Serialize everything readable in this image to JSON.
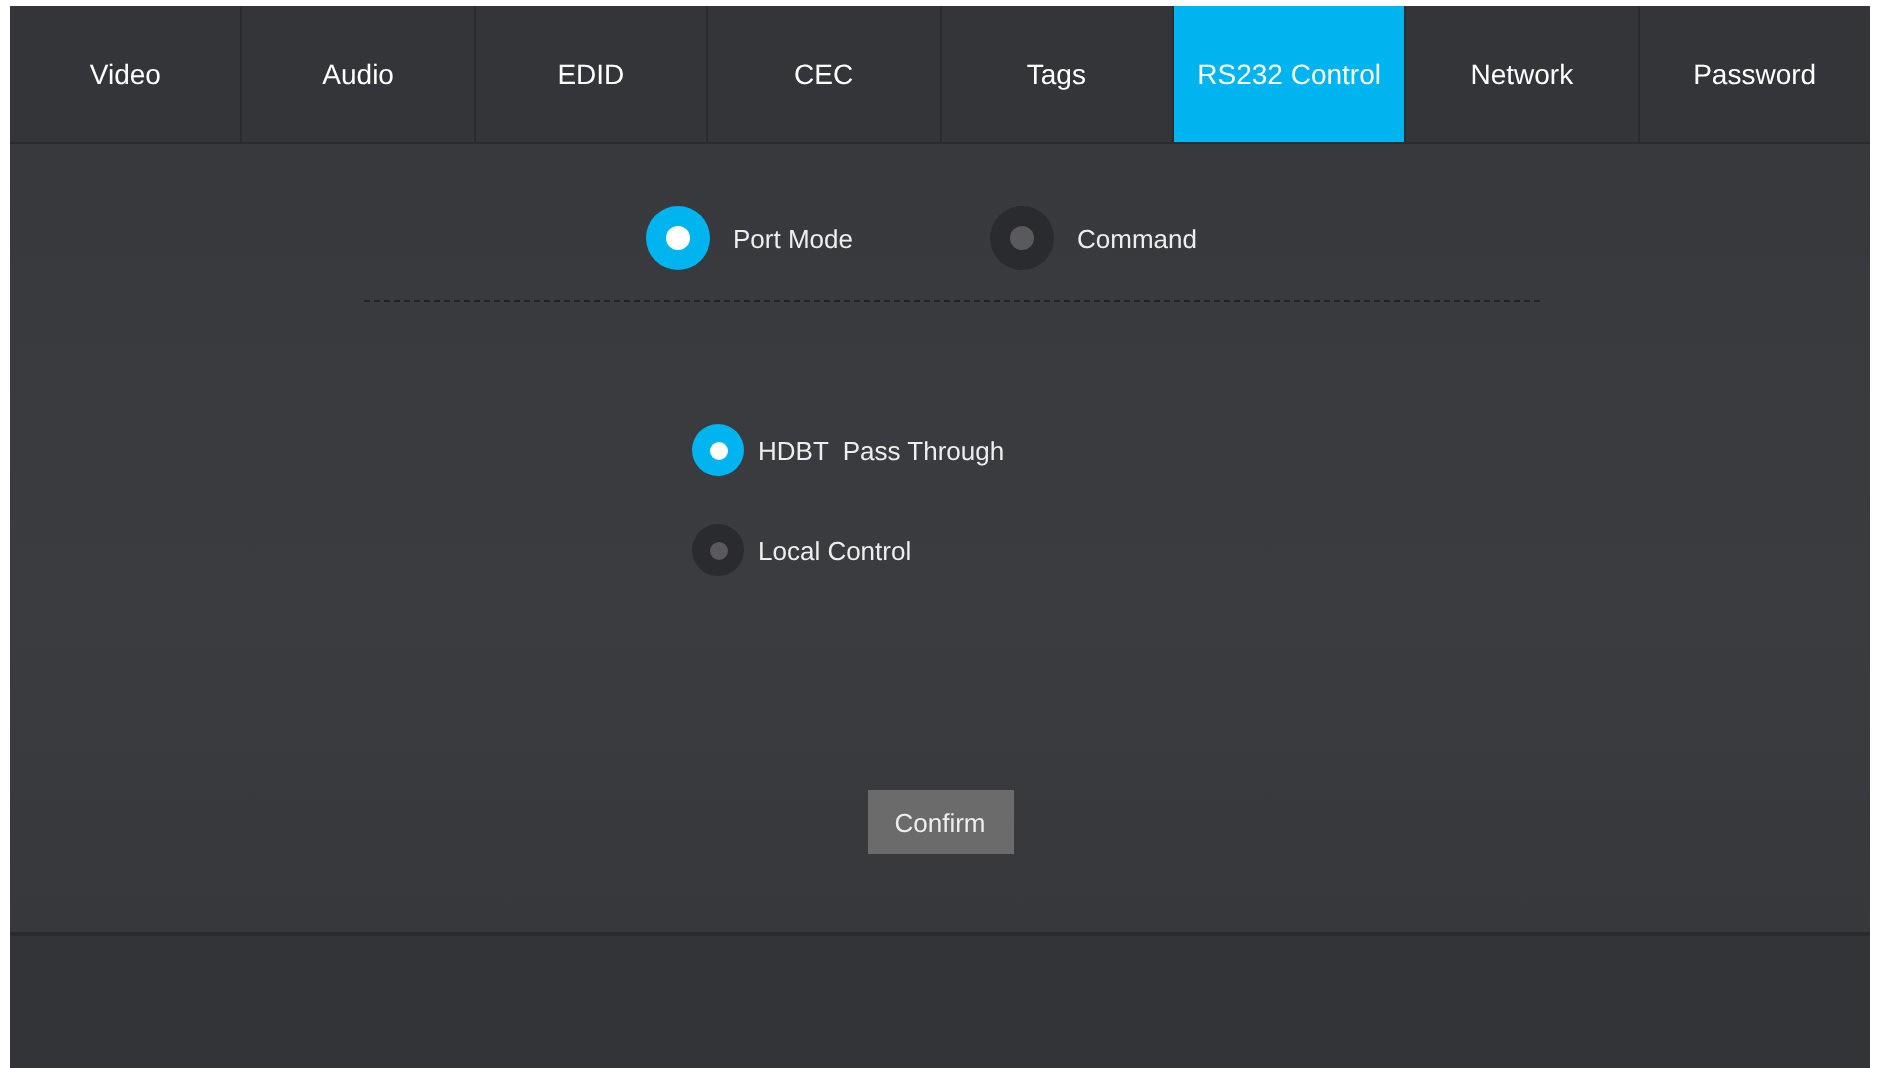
{
  "tabs": [
    {
      "label": "Video",
      "selected": false
    },
    {
      "label": "Audio",
      "selected": false
    },
    {
      "label": "EDID",
      "selected": false
    },
    {
      "label": "CEC",
      "selected": false
    },
    {
      "label": "Tags",
      "selected": false
    },
    {
      "label": "RS232 Control",
      "selected": true
    },
    {
      "label": "Network",
      "selected": false
    },
    {
      "label": "Password",
      "selected": false
    }
  ],
  "modes": [
    {
      "label": "Port Mode",
      "selected": true
    },
    {
      "label": "Command",
      "selected": false
    }
  ],
  "port_options": [
    {
      "label": "HDBT  Pass Through",
      "selected": true
    },
    {
      "label": "Local Control",
      "selected": false
    }
  ],
  "confirm_button": "Confirm"
}
